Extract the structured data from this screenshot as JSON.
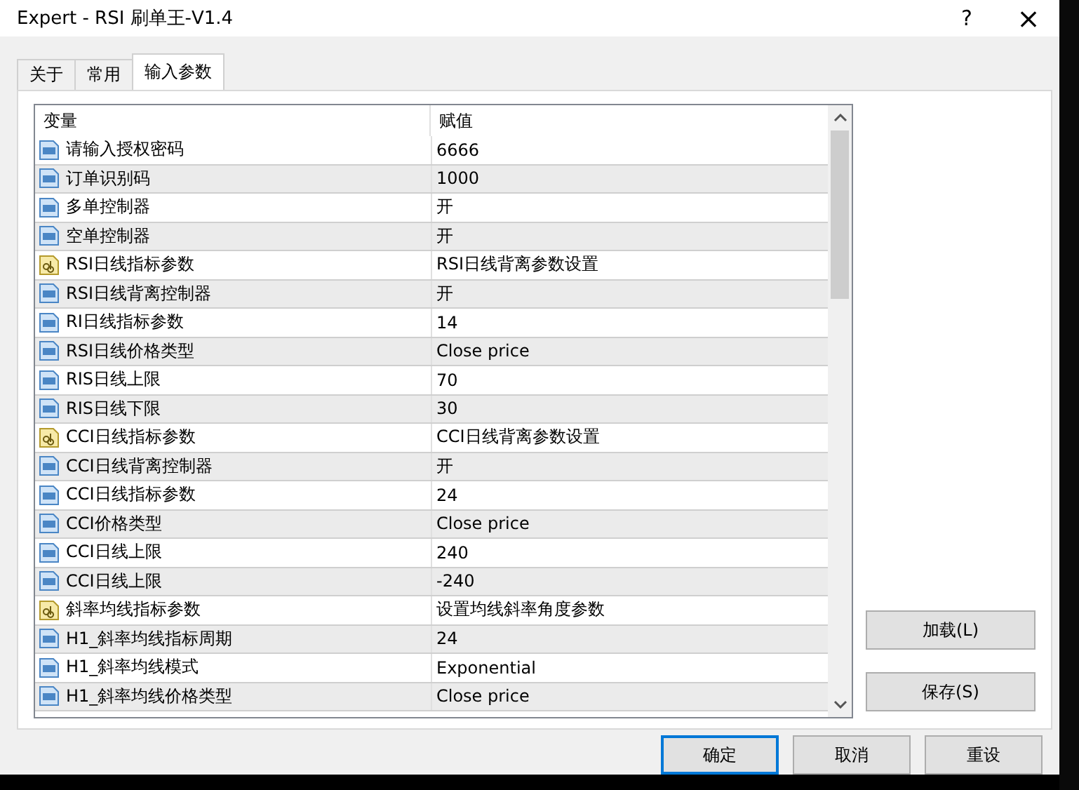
{
  "window": {
    "title": "Expert - RSI 刷单王-V1.4",
    "help": "?",
    "close": "×"
  },
  "tabs": [
    {
      "label": "关于",
      "selected": false
    },
    {
      "label": "常用",
      "selected": false
    },
    {
      "label": "输入参数",
      "selected": true
    }
  ],
  "table": {
    "columns": [
      "变量",
      "赋值"
    ],
    "rows": [
      {
        "kind": "number",
        "name": "请输入授权密码",
        "value": "6666"
      },
      {
        "kind": "number",
        "name": "订单识别码",
        "value": "1000"
      },
      {
        "kind": "number",
        "name": "多单控制器",
        "value": "开"
      },
      {
        "kind": "number",
        "name": "空单控制器",
        "value": "开"
      },
      {
        "kind": "string",
        "name": "RSI日线指标参数",
        "value": "RSI日线背离参数设置"
      },
      {
        "kind": "number",
        "name": "RSI日线背离控制器",
        "value": "开"
      },
      {
        "kind": "number",
        "name": "RI日线指标参数",
        "value": "14"
      },
      {
        "kind": "number",
        "name": "RSI日线价格类型",
        "value": "Close price"
      },
      {
        "kind": "number",
        "name": "RIS日线上限",
        "value": "70"
      },
      {
        "kind": "number",
        "name": "RIS日线下限",
        "value": "30"
      },
      {
        "kind": "string",
        "name": "CCI日线指标参数",
        "value": "CCI日线背离参数设置"
      },
      {
        "kind": "number",
        "name": "CCI日线背离控制器",
        "value": "开"
      },
      {
        "kind": "number",
        "name": "CCI日线指标参数",
        "value": "24"
      },
      {
        "kind": "number",
        "name": "CCI价格类型",
        "value": "Close price"
      },
      {
        "kind": "number",
        "name": "CCI日线上限",
        "value": "240"
      },
      {
        "kind": "number",
        "name": "CCI日线上限",
        "value": "-240"
      },
      {
        "kind": "string",
        "name": "斜率均线指标参数",
        "value": "设置均线斜率角度参数"
      },
      {
        "kind": "number",
        "name": "H1_斜率均线指标周期",
        "value": "24"
      },
      {
        "kind": "number",
        "name": "H1_斜率均线模式",
        "value": "Exponential"
      },
      {
        "kind": "number",
        "name": "H1_斜率均线价格类型",
        "value": "Close price"
      }
    ]
  },
  "side_buttons": [
    "加载(L)",
    "保存(S)"
  ],
  "buttons": [
    {
      "label": "确定",
      "selected": true
    },
    {
      "label": "取消",
      "selected": false
    },
    {
      "label": "重设",
      "selected": false
    }
  ]
}
